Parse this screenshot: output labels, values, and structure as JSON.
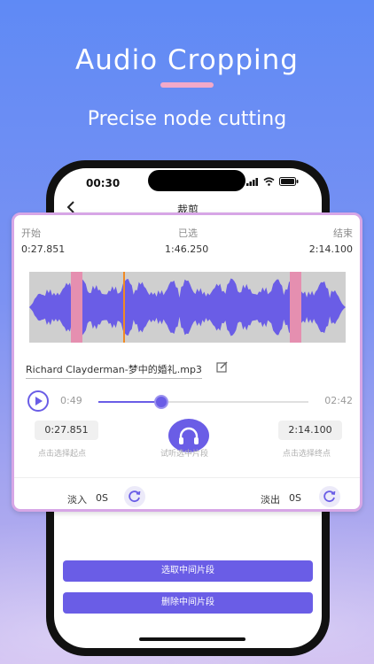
{
  "promo": {
    "headline": "Audio Cropping",
    "subheadline": "Precise node cutting"
  },
  "status_bar": {
    "time": "00:30"
  },
  "nav": {
    "back_icon": "chevron-left-icon",
    "title": "裁剪"
  },
  "markers": {
    "start_label": "开始",
    "selected_label": "已选",
    "end_label": "结束",
    "start_time": "0:27.851",
    "selected_time": "1:46.250",
    "end_time": "2:14.100"
  },
  "file": {
    "name": "Richard Clayderman-梦中的婚礼.mp3",
    "edit_icon": "edit-icon"
  },
  "player": {
    "current": "0:49",
    "total": "02:42",
    "progress_fraction": 0.3
  },
  "selection": {
    "start_value": "0:27.851",
    "start_hint": "点击选择起点",
    "listen_label": "试听选中片段",
    "end_value": "2:14.100",
    "end_hint": "点击选择终点"
  },
  "fade": {
    "in_label": "淡入",
    "in_value": "0S",
    "out_label": "淡出",
    "out_value": "0S"
  },
  "actions": {
    "select_middle": "选取中间片段",
    "delete_middle": "删除中间片段"
  },
  "colors": {
    "accent": "#6a5de6",
    "marker_pink": "#e58fb0",
    "playhead": "#f08a24",
    "card_border": "#d7a6e6"
  }
}
